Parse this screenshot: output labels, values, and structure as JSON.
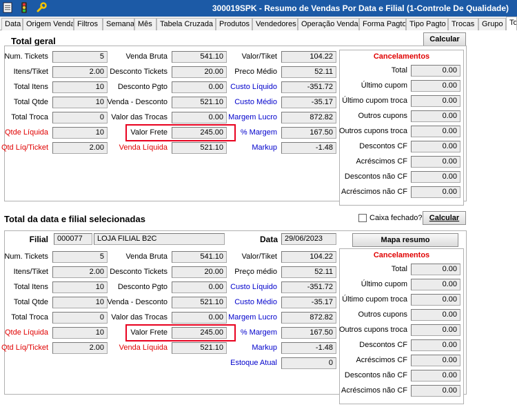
{
  "window": {
    "title": "300019SPK - Resumo de Vendas Por Data e Filial (1-Controle De Qualidade)"
  },
  "toolbar_icons": [
    "menu-icon",
    "traffic-light-icon",
    "wrench-icon"
  ],
  "tabs": [
    "Data",
    "Origem Venda",
    "Filtros",
    "Semana",
    "Mês",
    "Tabela Cruzada",
    "Produtos",
    "Vendedores",
    "Operação Venda",
    "Forma Pagto",
    "Tipo Pagto",
    "Trocas",
    "Grupo",
    "To"
  ],
  "total_geral": {
    "title": "Total geral",
    "calc_button": "Calcular",
    "col1": [
      {
        "label": "Num. Tickets",
        "value": "5",
        "color": "black"
      },
      {
        "label": "Itens/Tiket",
        "value": "2.00",
        "color": "black"
      },
      {
        "label": "Total Itens",
        "value": "10",
        "color": "black"
      },
      {
        "label": "Total Qtde",
        "value": "10",
        "color": "black"
      },
      {
        "label": "Total Troca",
        "value": "0",
        "color": "black"
      },
      {
        "label": "Qtde Líquida",
        "value": "10",
        "color": "red"
      },
      {
        "label": "Qtd Líq/Ticket",
        "value": "2.00",
        "color": "red"
      }
    ],
    "col2": [
      {
        "label": "Venda Bruta",
        "value": "541.10",
        "color": "black"
      },
      {
        "label": "Desconto Tickets",
        "value": "20.00",
        "color": "black"
      },
      {
        "label": "Desconto Pgto",
        "value": "0.00",
        "color": "black"
      },
      {
        "label": "Venda - Desconto",
        "value": "521.10",
        "color": "black"
      },
      {
        "label": "Valor das Trocas",
        "value": "0.00",
        "color": "black"
      },
      {
        "label": "Valor Frete",
        "value": "245.00",
        "color": "black"
      },
      {
        "label": "Venda Líquida",
        "value": "521.10",
        "color": "red"
      }
    ],
    "col3": [
      {
        "label": "Valor/Tiket",
        "value": "104.22",
        "color": "black"
      },
      {
        "label": "Preco Médio",
        "value": "52.11",
        "color": "black"
      },
      {
        "label": "Custo Líquido",
        "value": "-351.72",
        "color": "blue"
      },
      {
        "label": "Custo Médio",
        "value": "-35.17",
        "color": "blue"
      },
      {
        "label": "Margem Lucro",
        "value": "872.82",
        "color": "blue"
      },
      {
        "label": "% Margem",
        "value": "167.50",
        "color": "blue"
      },
      {
        "label": "Markup",
        "value": "-1.48",
        "color": "blue"
      }
    ],
    "cancel_title": "Cancelamentos",
    "cancel": [
      {
        "label": "Total",
        "value": "0.00"
      },
      {
        "label": "Último cupom",
        "value": "0.00"
      },
      {
        "label": "Último cupom troca",
        "value": "0.00"
      },
      {
        "label": "Outros cupons",
        "value": "0.00"
      },
      {
        "label": "Outros cupons troca",
        "value": "0.00"
      },
      {
        "label": "Descontos CF",
        "value": "0.00"
      },
      {
        "label": "Acréscimos CF",
        "value": "0.00"
      },
      {
        "label": "Descontos não CF",
        "value": "0.00"
      },
      {
        "label": "Acréscimos não CF",
        "value": "0.00"
      }
    ]
  },
  "total_data_filial": {
    "title": "Total da data e filial selecionadas",
    "caixa_label": "Caixa fechado?",
    "calc_button": "Calcular",
    "filial_label": "Filial",
    "filial_code": "000077",
    "filial_name": "LOJA FILIAL B2C",
    "data_label": "Data",
    "data_value": "29/06/2023",
    "mapa_button": "Mapa resumo",
    "col1": [
      {
        "label": "Num. Tickets",
        "value": "5",
        "color": "black"
      },
      {
        "label": "Itens/Tiket",
        "value": "2.00",
        "color": "black"
      },
      {
        "label": "Total Itens",
        "value": "10",
        "color": "black"
      },
      {
        "label": "Total Qtde",
        "value": "10",
        "color": "black"
      },
      {
        "label": "Total Troca",
        "value": "0",
        "color": "black"
      },
      {
        "label": "Qtde Líquida",
        "value": "10",
        "color": "red"
      },
      {
        "label": "Qtd Líq/Ticket",
        "value": "2.00",
        "color": "red"
      }
    ],
    "col2": [
      {
        "label": "Venda Bruta",
        "value": "541.10",
        "color": "black"
      },
      {
        "label": "Desconto Tickets",
        "value": "20.00",
        "color": "black"
      },
      {
        "label": "Desconto Pgto",
        "value": "0.00",
        "color": "black"
      },
      {
        "label": "Venda - Desconto",
        "value": "521.10",
        "color": "black"
      },
      {
        "label": "Valor das Trocas",
        "value": "0.00",
        "color": "black"
      },
      {
        "label": "Valor Frete",
        "value": "245.00",
        "color": "black"
      },
      {
        "label": "Venda Líquida",
        "value": "521.10",
        "color": "red"
      }
    ],
    "col3": [
      {
        "label": "Valor/Tiket",
        "value": "104.22",
        "color": "black"
      },
      {
        "label": "Preço médio",
        "value": "52.11",
        "color": "black"
      },
      {
        "label": "Custo Líquido",
        "value": "-351.72",
        "color": "blue"
      },
      {
        "label": "Custo Médio",
        "value": "-35.17",
        "color": "blue"
      },
      {
        "label": "Margem Lucro",
        "value": "872.82",
        "color": "blue"
      },
      {
        "label": "% Margem",
        "value": "167.50",
        "color": "blue"
      },
      {
        "label": "Markup",
        "value": "-1.48",
        "color": "blue"
      },
      {
        "label": "Estoque Atual",
        "value": "0",
        "color": "blue"
      }
    ],
    "cancel_title": "Cancelamentos",
    "cancel": [
      {
        "label": "Total",
        "value": "0.00"
      },
      {
        "label": "Último cupom",
        "value": "0.00"
      },
      {
        "label": "Último cupom troca",
        "value": "0.00"
      },
      {
        "label": "Outros cupons",
        "value": "0.00"
      },
      {
        "label": "Outros cupons troca",
        "value": "0.00"
      },
      {
        "label": "Descontos CF",
        "value": "0.00"
      },
      {
        "label": "Acréscimos CF",
        "value": "0.00"
      },
      {
        "label": "Descontos não CF",
        "value": "0.00"
      },
      {
        "label": "Acréscimos não CF",
        "value": "0.00"
      }
    ]
  },
  "colors": {
    "title_bar": "#1c5aa6",
    "label_red": "#e00000",
    "label_blue": "#0000cc",
    "highlight_box": "#e8001e"
  }
}
